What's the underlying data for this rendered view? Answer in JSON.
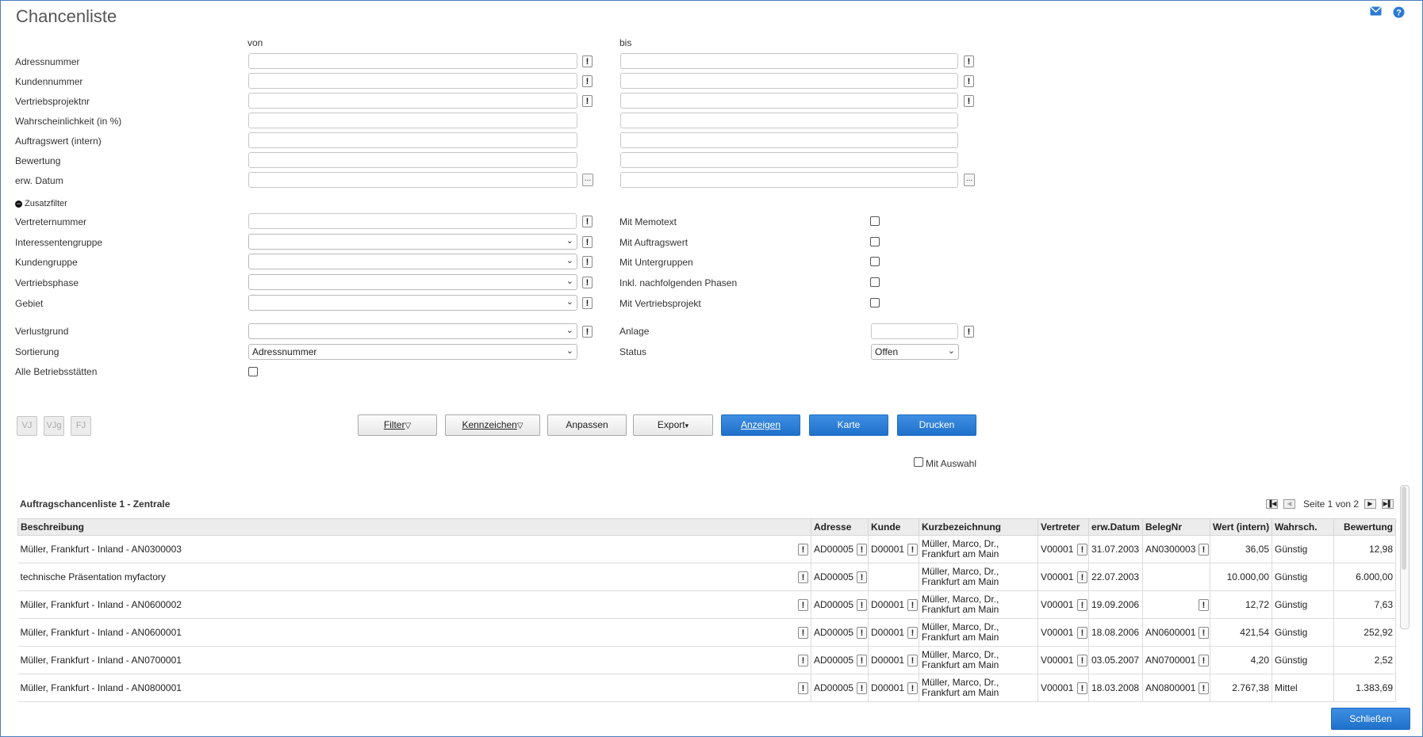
{
  "page": {
    "title": "Chancenliste"
  },
  "header_icons": [
    "mail-icon",
    "help-icon"
  ],
  "filter": {
    "col_from": "von",
    "col_to": "bis",
    "rows": [
      "Adressnummer",
      "Kundennummer",
      "Vertriebsprojektnr",
      "Wahrscheinlichkeit (in %)",
      "Auftragswert (intern)",
      "Bewertung",
      "erw. Datum"
    ],
    "zusatzfilter_label": "Zusatzfilter",
    "extra_left": [
      "Vertreternummer",
      "Interessentengruppe",
      "Kundengruppe",
      "Vertriebsphase",
      "Gebiet"
    ],
    "extra_right": [
      "Mit Memotext",
      "Mit Auftragswert",
      "Mit Untergruppen",
      "Inkl. nachfolgenden Phasen",
      "Mit Vertriebsprojekt"
    ],
    "verlustgrund_label": "Verlustgrund",
    "sortierung_label": "Sortierung",
    "sortierung_value": "Adressnummer",
    "alle_betriebsstaetten_label": "Alle Betriebsstätten",
    "anlage_label": "Anlage",
    "status_label": "Status",
    "status_value": "Offen",
    "dots_label": "..."
  },
  "toolbar": {
    "small": [
      "VJ",
      "VJg",
      "FJ"
    ],
    "filter": "Filter",
    "kennzeichen": "Kennzeichen",
    "anpassen": "Anpassen",
    "export": "Export",
    "anzeigen": "Anzeigen",
    "karte": "Karte",
    "drucken": "Drucken",
    "mit_auswahl": "Mit Auswahl"
  },
  "grid": {
    "title": "Auftragschancenliste 1 - Zentrale",
    "pager_text": "Seite 1 von 2",
    "columns": [
      "Beschreibung",
      "Adresse",
      "Kunde",
      "Kurzbezeichnung",
      "Vertreter",
      "erw.Datum",
      "BelegNr",
      "Wert (intern)",
      "Wahrsch.",
      "Bewertung"
    ],
    "rows": [
      {
        "beschreibung": "Müller, Frankfurt - Inland - AN0300003",
        "adresse": "AD00005",
        "kunde": "D00001",
        "kurz1": "Müller, Marco, Dr.,",
        "kurz2": "Frankfurt am Main",
        "vertreter": "V00001",
        "datum": "31.07.2003",
        "beleg": "AN0300003",
        "wert": "36,05",
        "wahrsch": "Günstig",
        "bewertung": "12,98"
      },
      {
        "beschreibung": "technische Präsentation myfactory",
        "adresse": "AD00005",
        "kunde": "",
        "kurz1": "Müller, Marco, Dr.,",
        "kurz2": "Frankfurt am Main",
        "vertreter": "V00001",
        "datum": "22.07.2003",
        "beleg": "",
        "wert": "10.000,00",
        "wahrsch": "Günstig",
        "bewertung": "6.000,00"
      },
      {
        "beschreibung": "Müller, Frankfurt - Inland - AN0600002",
        "adresse": "AD00005",
        "kunde": "D00001",
        "kurz1": "Müller, Marco, Dr.,",
        "kurz2": "Frankfurt am Main",
        "vertreter": "V00001",
        "datum": "19.09.2006",
        "beleg": "",
        "wert": "12,72",
        "wahrsch": "Günstig",
        "bewertung": "7,63"
      },
      {
        "beschreibung": "Müller, Frankfurt - Inland - AN0600001",
        "adresse": "AD00005",
        "kunde": "D00001",
        "kurz1": "Müller, Marco, Dr.,",
        "kurz2": "Frankfurt am Main",
        "vertreter": "V00001",
        "datum": "18.08.2006",
        "beleg": "AN0600001",
        "wert": "421,54",
        "wahrsch": "Günstig",
        "bewertung": "252,92"
      },
      {
        "beschreibung": "Müller, Frankfurt - Inland - AN0700001",
        "adresse": "AD00005",
        "kunde": "D00001",
        "kurz1": "Müller, Marco, Dr.,",
        "kurz2": "Frankfurt am Main",
        "vertreter": "V00001",
        "datum": "03.05.2007",
        "beleg": "AN0700001",
        "wert": "4,20",
        "wahrsch": "Günstig",
        "bewertung": "2,52"
      },
      {
        "beschreibung": "Müller, Frankfurt - Inland - AN0800001",
        "adresse": "AD00005",
        "kunde": "D00001",
        "kurz1": "Müller, Marco, Dr.,",
        "kurz2": "Frankfurt am Main",
        "vertreter": "V00001",
        "datum": "18.03.2008",
        "beleg": "AN0800001",
        "wert": "2.767,38",
        "wahrsch": "Mittel",
        "bewertung": "1.383,69"
      }
    ],
    "cell_icon_label": "!"
  },
  "footer": {
    "schliessen": "Schließen"
  },
  "colors": {
    "primary": "#2a7ad6",
    "frame": "#4a7fc0"
  }
}
